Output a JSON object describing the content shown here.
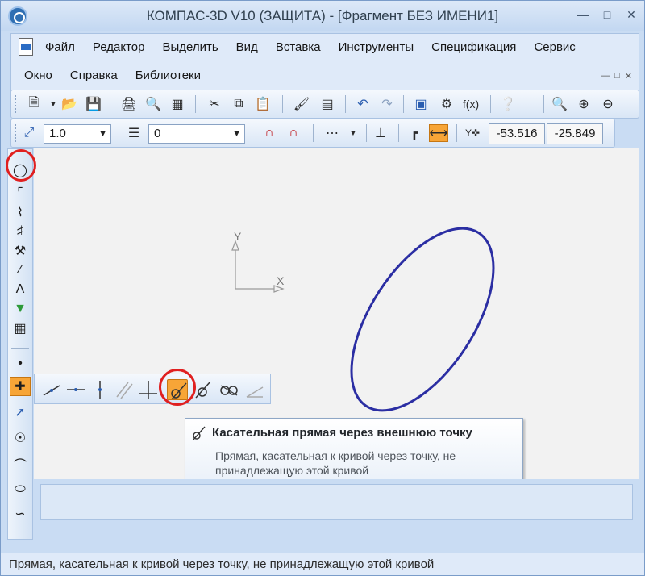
{
  "window": {
    "title": "КОМПАС-3D V10 (ЗАЩИТА) - [Фрагмент БЕЗ ИМЕНИ1]",
    "controls": [
      "minimize",
      "maximize",
      "close"
    ]
  },
  "menu": {
    "row1": [
      "Файл",
      "Редактор",
      "Выделить",
      "Вид",
      "Вставка",
      "Инструменты",
      "Спецификация",
      "Сервис"
    ],
    "row2": [
      "Окно",
      "Справка",
      "Библиотеки"
    ]
  },
  "current_parameters": {
    "scale": "1.0",
    "layer": "0",
    "cursor_x": "-53.516",
    "cursor_y": "-25.849"
  },
  "canvas": {
    "axis_x_label": "X",
    "axis_y_label": "Y",
    "ellipse_color": "#2b2ea3"
  },
  "tooltip": {
    "title": "Касательная прямая через внешнюю точку",
    "body": "Прямая, касательная к кривой через точку, не принадлежащую этой кривой"
  },
  "status": {
    "text": "Прямая, касательная к кривой через точку, не принадлежащую этой кривой"
  },
  "highlight_color": "#e02020",
  "active_color": "#f7a537"
}
